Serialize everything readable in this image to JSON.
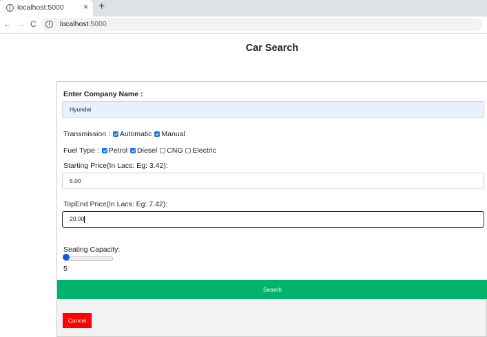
{
  "browser": {
    "tab_title": "localhost:5000",
    "tab_close": "×",
    "new_tab": "+",
    "back": "←",
    "forward": "→",
    "reload": "C",
    "info": "i",
    "url_host": "localhost",
    "url_port": ":5000"
  },
  "page": {
    "title": "Car Search"
  },
  "form": {
    "company_label": "Enter Company Name :",
    "company_value": "Hyundai",
    "transmission": {
      "label": "Transmission :",
      "options": [
        {
          "label": "Automatic",
          "checked": true
        },
        {
          "label": "Manual",
          "checked": true
        }
      ]
    },
    "fuel": {
      "label": "Fuel Type :",
      "options": [
        {
          "label": "Petrol",
          "checked": true
        },
        {
          "label": "Diesel",
          "checked": true
        },
        {
          "label": "CNG",
          "checked": false
        },
        {
          "label": "Electric",
          "checked": false
        }
      ]
    },
    "start_price_label": "Starting Price(In Lacs: Eg: 3.42):",
    "start_price_value": "5.00",
    "top_price_label": "TopEnd Price(In Lacs: Eg: 7.42):",
    "top_price_value": "20.00",
    "seating_label": "Seating Capacity:",
    "seating_value": "5",
    "search_label": "Search",
    "cancel_label": "Cancel"
  },
  "colors": {
    "search_button": "#00b36b",
    "cancel_button": "#ff0000",
    "checkbox_checked": "#1a73e8",
    "slider_thumb": "#1a56db",
    "autofill_bg": "#e8f0fe"
  }
}
